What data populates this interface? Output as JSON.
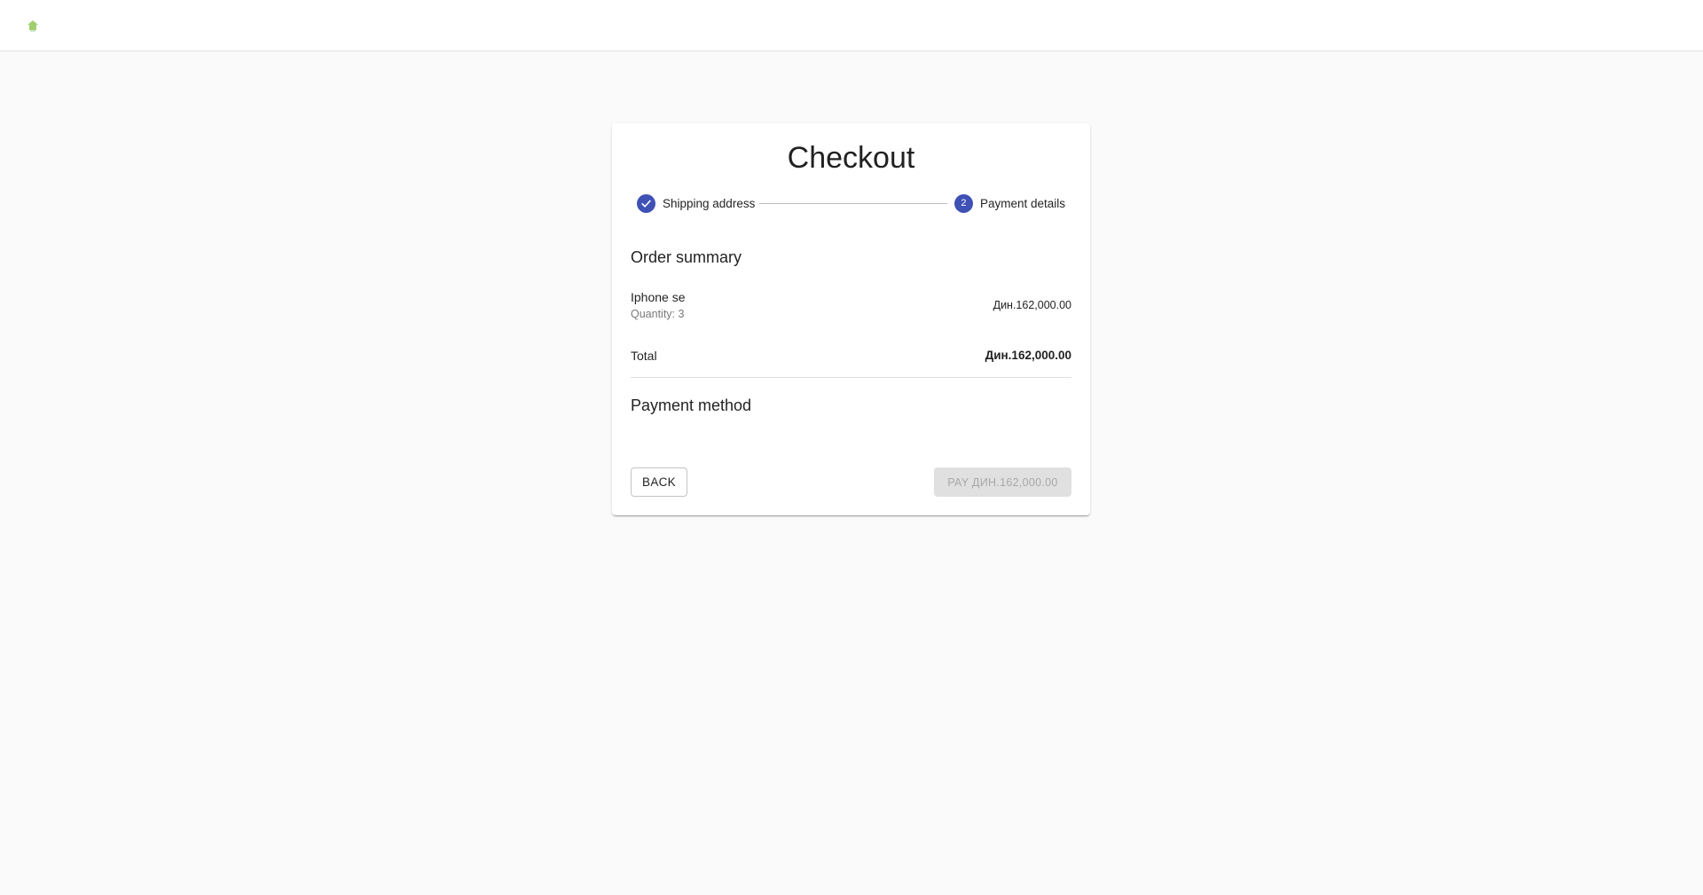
{
  "app": {
    "logo_icon": "house-logo-icon",
    "logo_color": "#7cb342"
  },
  "checkout": {
    "title": "Checkout",
    "accent_color": "#3f51b5",
    "steps": [
      {
        "label": "Shipping address",
        "state": "completed",
        "icon": "check-icon"
      },
      {
        "label": "Payment details",
        "state": "active",
        "number": "2"
      }
    ],
    "order_summary": {
      "title": "Order summary",
      "items": [
        {
          "name": "Iphone se",
          "quantity": "Quantity: 3",
          "price": "Дин.162,000.00"
        }
      ],
      "total_label": "Total",
      "total_value": "Дин.162,000.00"
    },
    "payment_method": {
      "title": "Payment method"
    },
    "buttons": {
      "back": "Back",
      "pay": "PAY ДИН.162,000.00",
      "pay_disabled": true
    }
  }
}
